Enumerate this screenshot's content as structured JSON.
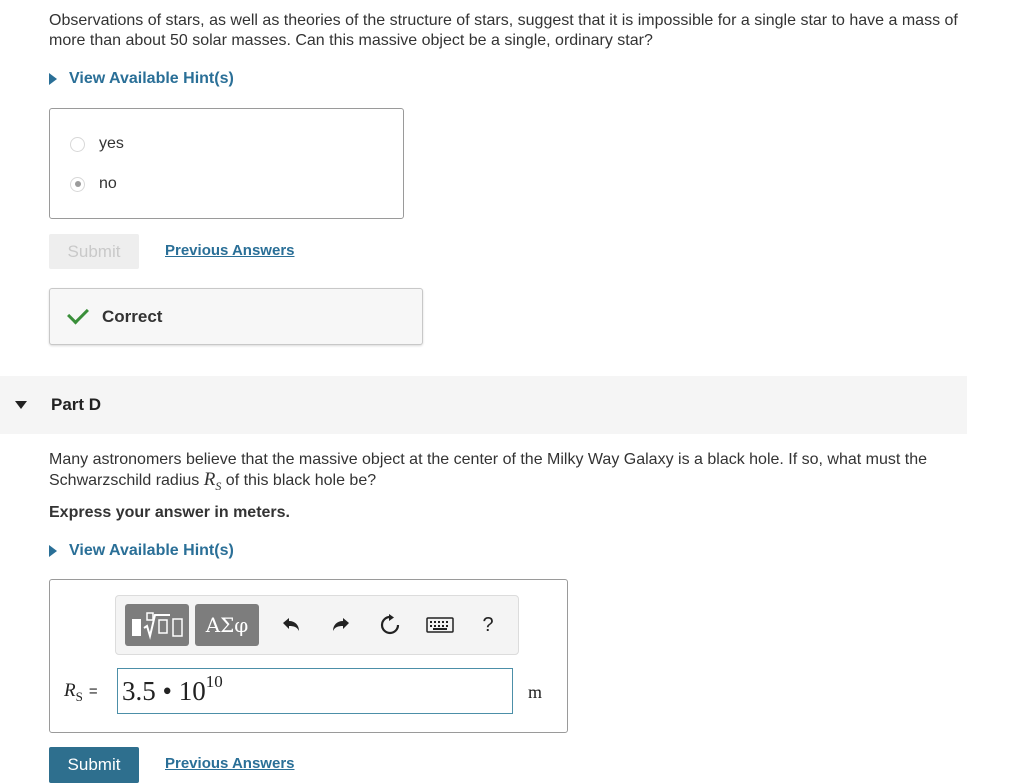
{
  "partC": {
    "question": "Observations of stars, as well as theories of the structure of stars, suggest that it is impossible for a single star to have a mass of more than about 50 solar masses. Can this massive object be a single, ordinary star?",
    "hint_label": "View Available Hint(s)",
    "choices": [
      {
        "label": "yes",
        "selected": false
      },
      {
        "label": "no",
        "selected": true
      }
    ],
    "submit_label": "Submit",
    "previous_answers_label": "Previous Answers",
    "feedback": "Correct"
  },
  "partD": {
    "title": "Part D",
    "question_before": "Many astronomers believe that the massive object at the center of the Milky Way Galaxy is a black hole. If so, what must the Schwarzschild radius ",
    "question_var": "R",
    "question_var_sub": "S",
    "question_after": " of this black hole be?",
    "instruction": "Express your answer in meters.",
    "hint_label": "View Available Hint(s)",
    "toolbar": {
      "template_icon": "fraction-sqrt-icon",
      "greek_label": "ΑΣφ",
      "undo_icon": "undo-icon",
      "redo_icon": "redo-icon",
      "reset_icon": "reset-icon",
      "keyboard_icon": "keyboard-icon",
      "help_label": "?"
    },
    "answer_var": "R",
    "answer_var_sub": "S",
    "answer_eq": "=",
    "answer_mantissa": "3.5 • 10",
    "answer_exponent": "10",
    "unit": "m",
    "submit_label": "Submit",
    "previous_answers_label": "Previous Answers"
  },
  "colors": {
    "link": "#2a6f97",
    "submit_bg": "#2e6f8e",
    "correct_check": "#3a8f3a"
  }
}
